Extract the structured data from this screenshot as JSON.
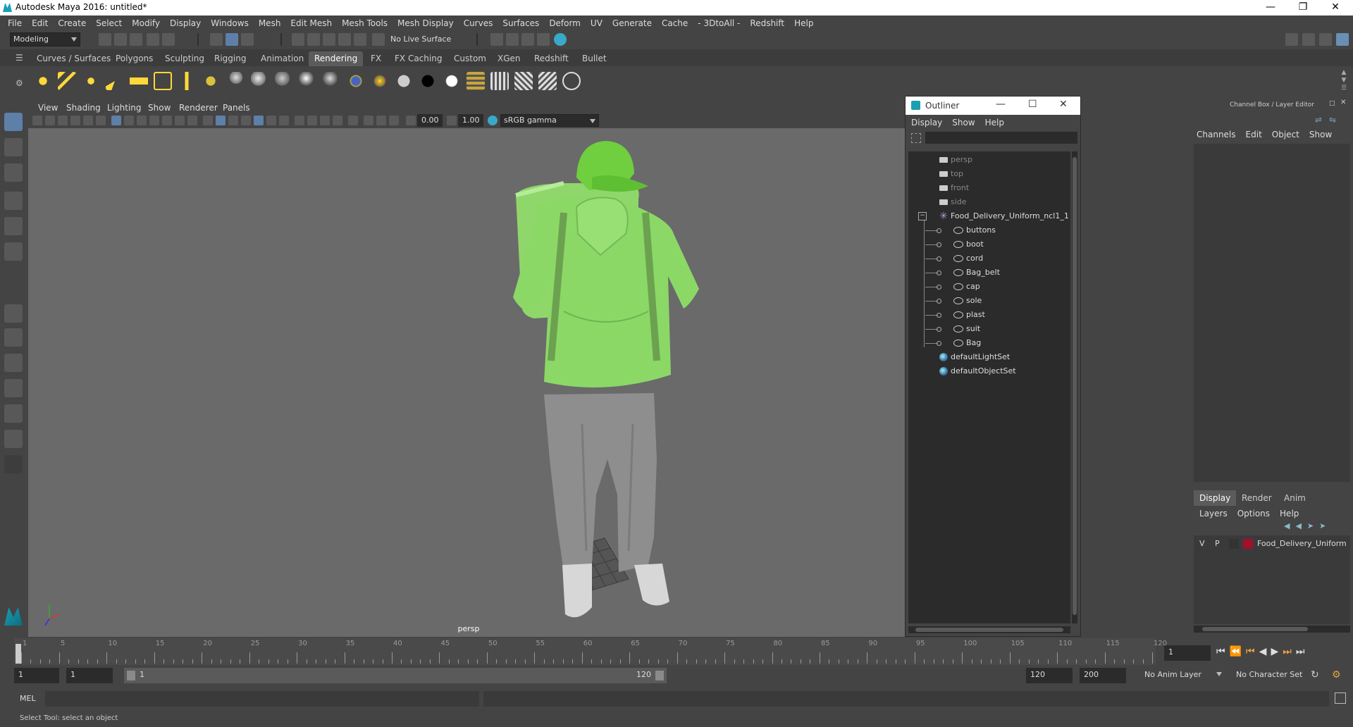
{
  "app": {
    "title": "Autodesk Maya 2016: untitled*"
  },
  "menubar": [
    "File",
    "Edit",
    "Create",
    "Select",
    "Modify",
    "Display",
    "Windows",
    "Mesh",
    "Edit Mesh",
    "Mesh Tools",
    "Mesh Display",
    "Curves",
    "Surfaces",
    "Deform",
    "UV",
    "Generate",
    "Cache",
    "- 3DtoAll -",
    "Redshift",
    "Help"
  ],
  "statusline": {
    "mode": "Modeling",
    "live_surface": "No Live Surface"
  },
  "shelf_tabs": [
    {
      "label": "Curves / Surfaces"
    },
    {
      "label": "Polygons"
    },
    {
      "label": "Sculpting"
    },
    {
      "label": "Rigging"
    },
    {
      "label": "Animation"
    },
    {
      "label": "Rendering",
      "active": true
    },
    {
      "label": "FX"
    },
    {
      "label": "FX Caching"
    },
    {
      "label": "Custom"
    },
    {
      "label": "XGen"
    },
    {
      "label": "Redshift"
    },
    {
      "label": "Bullet"
    }
  ],
  "viewport": {
    "menus": [
      "View",
      "Shading",
      "Lighting",
      "Show",
      "Renderer",
      "Panels"
    ],
    "exposure": "0.00",
    "gamma": "1.00",
    "color_space": "sRGB gamma",
    "camera_label": "persp"
  },
  "outliner": {
    "title": "Outliner",
    "menus": [
      "Display",
      "Show",
      "Help"
    ],
    "items": [
      {
        "label": "persp",
        "type": "camera",
        "indent": 0,
        "dim": true
      },
      {
        "label": "top",
        "type": "camera",
        "indent": 0,
        "dim": true
      },
      {
        "label": "front",
        "type": "camera",
        "indent": 0,
        "dim": true
      },
      {
        "label": "side",
        "type": "camera",
        "indent": 0,
        "dim": true
      },
      {
        "label": "Food_Delivery_Uniform_ncl1_1",
        "type": "group",
        "indent": 0,
        "expanded": true
      },
      {
        "label": "buttons",
        "type": "mesh",
        "indent": 1
      },
      {
        "label": "boot",
        "type": "mesh",
        "indent": 1
      },
      {
        "label": "cord",
        "type": "mesh",
        "indent": 1
      },
      {
        "label": "Bag_belt",
        "type": "mesh",
        "indent": 1
      },
      {
        "label": "cap",
        "type": "mesh",
        "indent": 1
      },
      {
        "label": "sole",
        "type": "mesh",
        "indent": 1
      },
      {
        "label": "plast",
        "type": "mesh",
        "indent": 1
      },
      {
        "label": "suit",
        "type": "mesh",
        "indent": 1
      },
      {
        "label": "Bag",
        "type": "mesh",
        "indent": 1
      },
      {
        "label": "defaultLightSet",
        "type": "set",
        "indent": 0
      },
      {
        "label": "defaultObjectSet",
        "type": "set",
        "indent": 0
      }
    ]
  },
  "channelbox": {
    "title": "Channel Box / Layer Editor",
    "menus": [
      "Channels",
      "Edit",
      "Object",
      "Show"
    ],
    "layer_tabs": [
      {
        "label": "Display",
        "active": true
      },
      {
        "label": "Render"
      },
      {
        "label": "Anim"
      }
    ],
    "layer_menus": [
      "Layers",
      "Options",
      "Help"
    ],
    "layers": [
      {
        "v": "V",
        "p": "P",
        "color": "#a0102a",
        "name": "Food_Delivery_Uniform"
      }
    ]
  },
  "timeline": {
    "ticks": [
      "1",
      "5",
      "10",
      "15",
      "20",
      "25",
      "30",
      "35",
      "40",
      "45",
      "50",
      "55",
      "60",
      "65",
      "70",
      "75",
      "80",
      "85",
      "90",
      "95",
      "100",
      "105",
      "110",
      "115",
      "120"
    ],
    "current_frame": "1"
  },
  "range": {
    "start": "1",
    "playback_start": "1",
    "slider_start": "1",
    "slider_end": "120",
    "playback_end": "120",
    "end": "200",
    "anim_layer": "No Anim Layer",
    "character_set": "No Character Set"
  },
  "cmdline": {
    "lang": "MEL"
  },
  "helpline": {
    "text": "Select Tool: select an object"
  },
  "colors": {
    "shirt": "#8ed86a",
    "pants": "#8f8f8f",
    "layer": "#a0102a",
    "accent": "#1a9fb3"
  }
}
